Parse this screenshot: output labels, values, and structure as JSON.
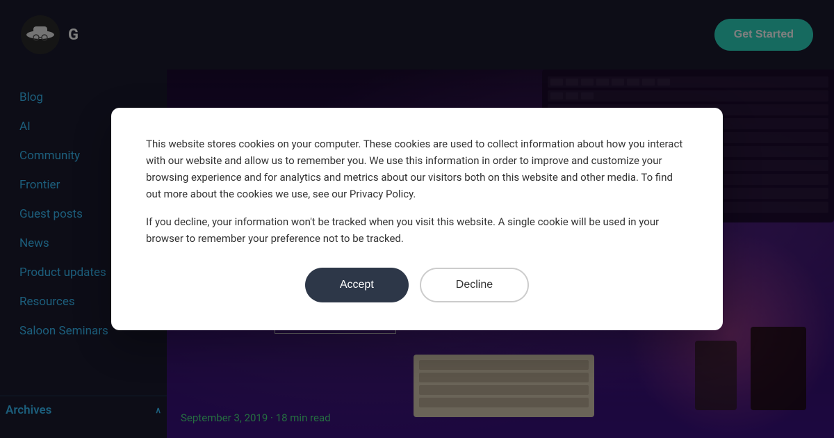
{
  "header": {
    "logo_text": "G",
    "get_started_label": "Get Started"
  },
  "sidebar": {
    "items": [
      {
        "id": "blog",
        "label": "Blog"
      },
      {
        "id": "ai",
        "label": "AI"
      },
      {
        "id": "community",
        "label": "Community"
      },
      {
        "id": "frontier",
        "label": "Frontier"
      },
      {
        "id": "guest-posts",
        "label": "Guest posts"
      },
      {
        "id": "news",
        "label": "News"
      },
      {
        "id": "product-updates",
        "label": "Product updates"
      },
      {
        "id": "resources",
        "label": "Resources"
      },
      {
        "id": "saloon-seminars",
        "label": "Saloon Seminars"
      }
    ],
    "archives_label": "Archives",
    "archives_chevron": "∧"
  },
  "article": {
    "date": "September 3, 2019",
    "read_time": "18 min read",
    "separator": "·"
  },
  "cookie": {
    "text1": "This website stores cookies on your computer. These cookies are used to collect information about how you interact with our website and allow us to remember you. We use this information in order to improve and customize your browsing experience and for analytics and metrics about our visitors both on this website and other media. To find out more about the cookies we use, see our Privacy Policy.",
    "text2": "If you decline, your information won't be tracked when you visit this website. A single cookie will be used in your browser to remember your preference not to be tracked.",
    "accept_label": "Accept",
    "decline_label": "Decline"
  }
}
